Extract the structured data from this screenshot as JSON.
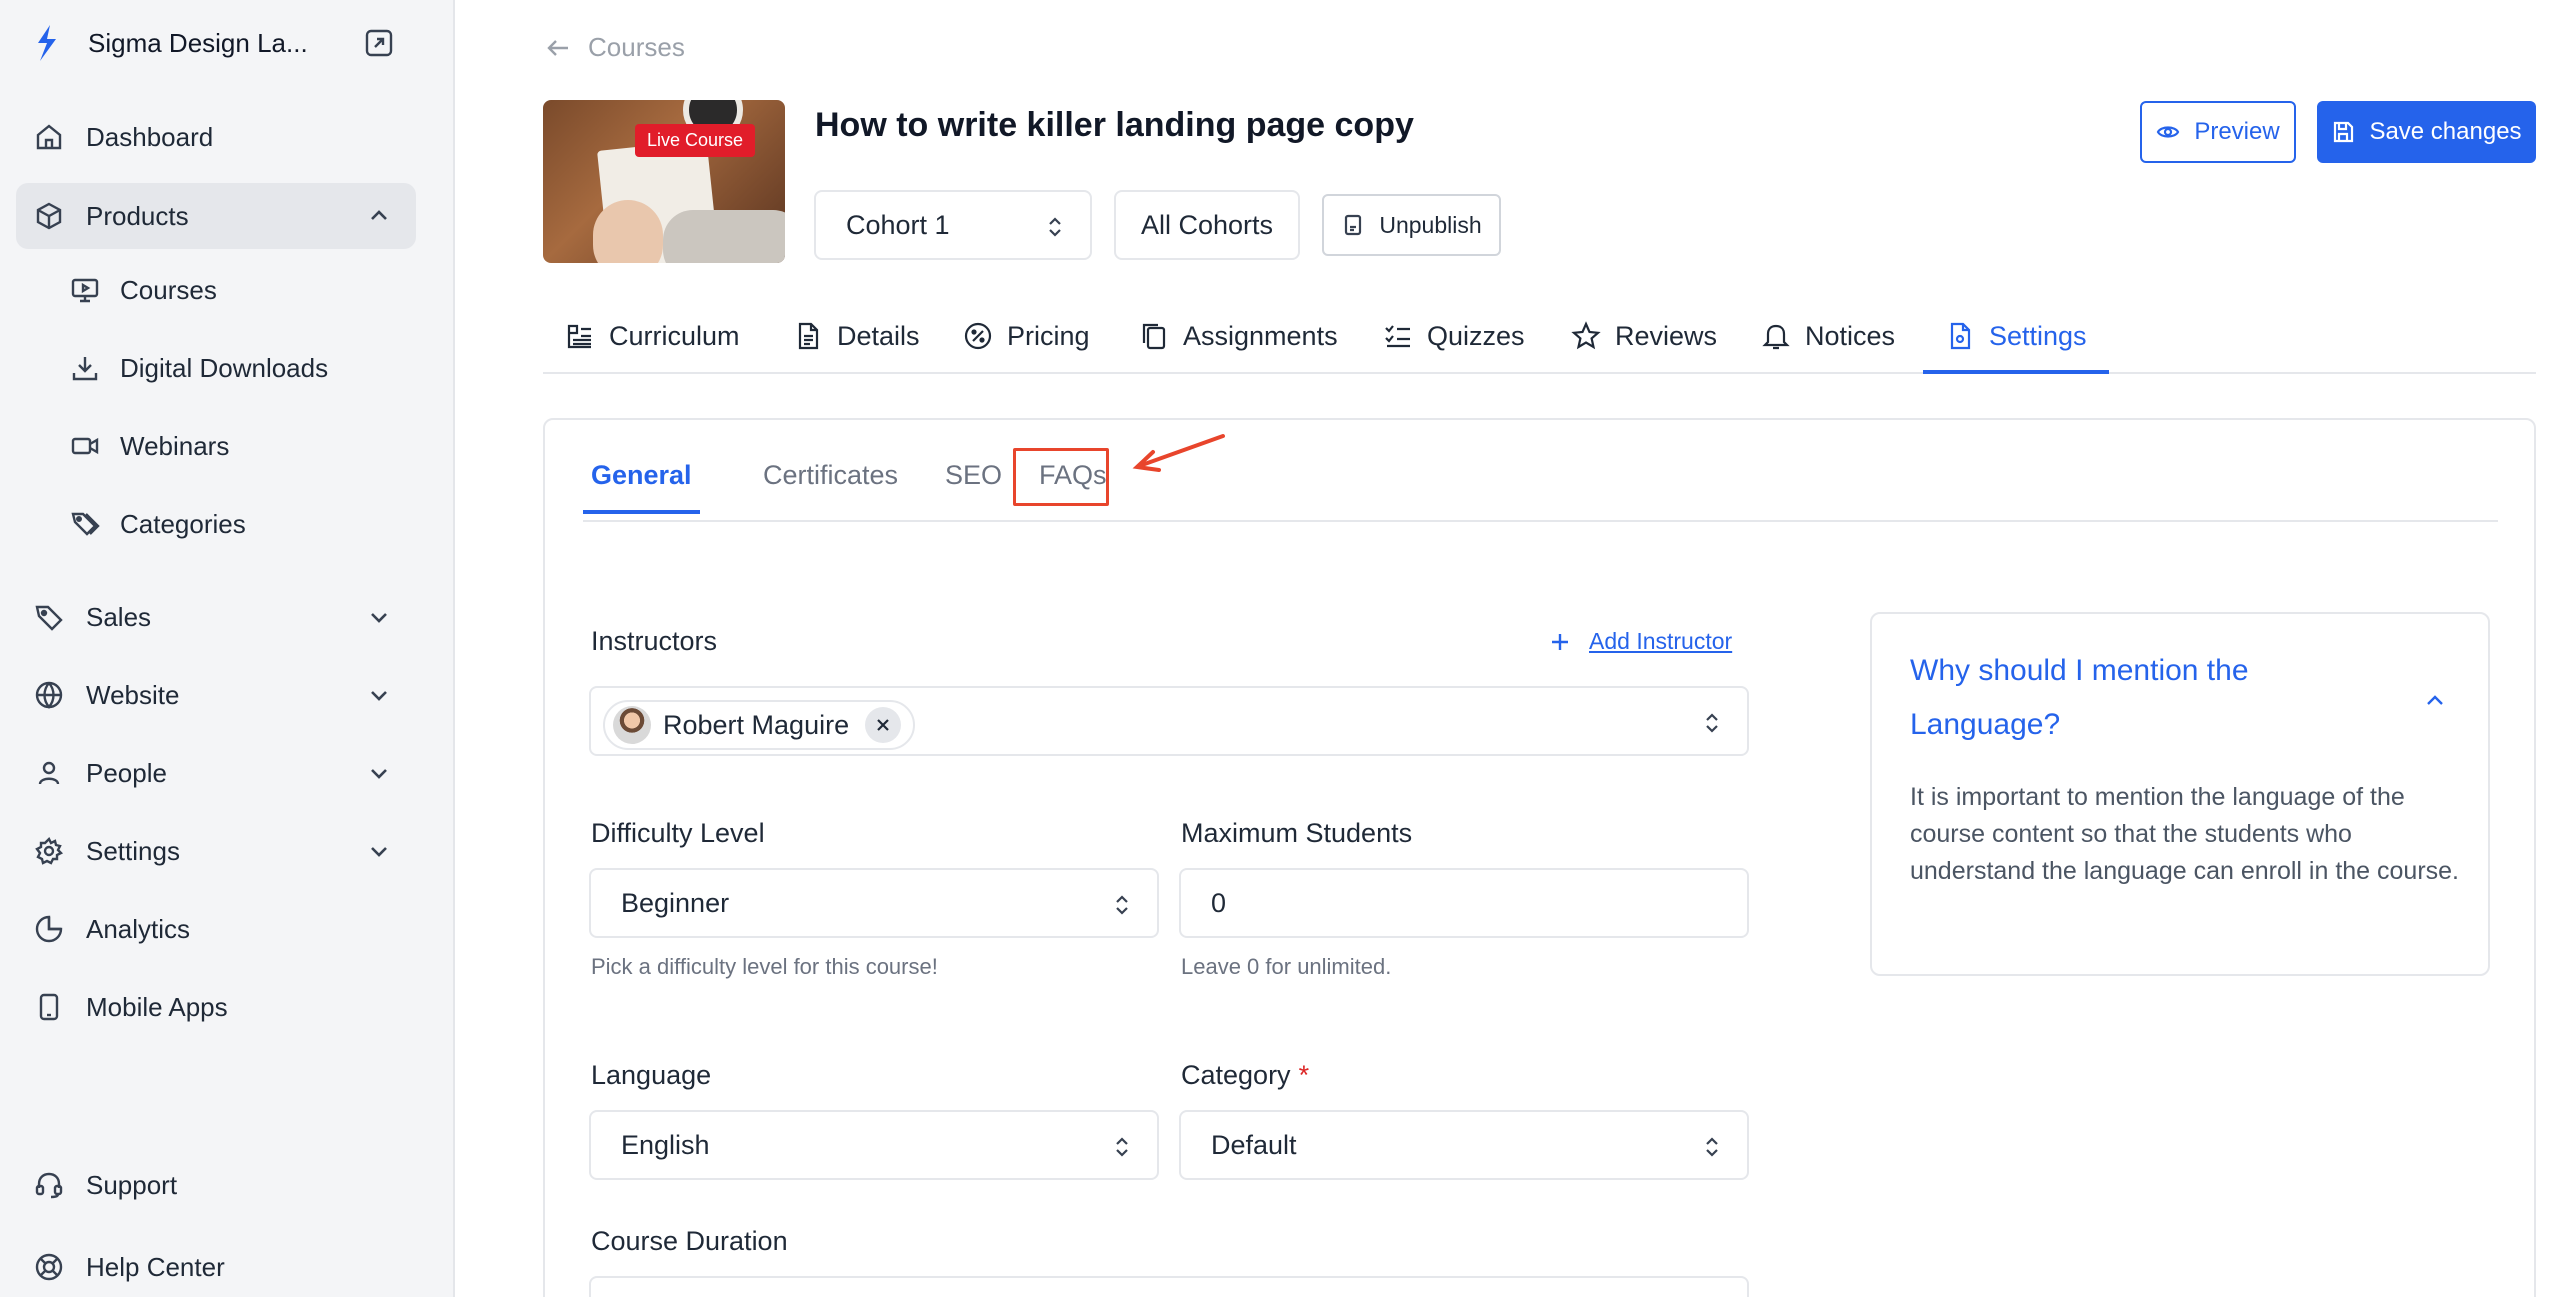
{
  "sidebar": {
    "brand_name": "Sigma Design La...",
    "items": [
      {
        "label": "Dashboard"
      },
      {
        "label": "Products"
      },
      {
        "label": "Sales"
      },
      {
        "label": "Website"
      },
      {
        "label": "People"
      },
      {
        "label": "Settings"
      },
      {
        "label": "Analytics"
      },
      {
        "label": "Mobile Apps"
      }
    ],
    "sub_items": [
      {
        "label": "Courses"
      },
      {
        "label": "Digital Downloads"
      },
      {
        "label": "Webinars"
      },
      {
        "label": "Categories"
      }
    ],
    "footer_items": [
      {
        "label": "Support"
      },
      {
        "label": "Help Center"
      }
    ]
  },
  "header": {
    "back_label": "Courses",
    "badge": "Live Course",
    "title": "How to write killer landing page copy",
    "preview_label": "Preview",
    "save_label": "Save changes",
    "cohort_value": "Cohort 1",
    "all_cohorts_label": "All Cohorts",
    "unpublish_label": "Unpublish"
  },
  "tabs": [
    {
      "label": "Curriculum"
    },
    {
      "label": "Details"
    },
    {
      "label": "Pricing"
    },
    {
      "label": "Assignments"
    },
    {
      "label": "Quizzes"
    },
    {
      "label": "Reviews"
    },
    {
      "label": "Notices"
    },
    {
      "label": "Settings",
      "active": true
    }
  ],
  "subtabs": [
    {
      "label": "General",
      "active": true
    },
    {
      "label": "Certificates"
    },
    {
      "label": "SEO"
    },
    {
      "label": "FAQs"
    }
  ],
  "form": {
    "instructors_label": "Instructors",
    "add_instructor_label": "Add Instructor",
    "instructor_chip": "Robert Maguire",
    "difficulty_label": "Difficulty Level",
    "difficulty_value": "Beginner",
    "difficulty_hint": "Pick a difficulty level for this course!",
    "max_students_label": "Maximum Students",
    "max_students_value": "0",
    "max_students_hint": "Leave 0 for unlimited.",
    "language_label": "Language",
    "language_value": "English",
    "category_label": "Category",
    "category_required": "*",
    "category_value": "Default",
    "duration_label": "Course Duration"
  },
  "info_panel": {
    "title": "Why should I mention the Language?",
    "body": "It is important to mention the language of the course content so that the students who understand the language can enroll in the course."
  },
  "colors": {
    "accent": "#2563eb",
    "highlight": "#e8452c",
    "live_badge": "#e11d2a"
  }
}
